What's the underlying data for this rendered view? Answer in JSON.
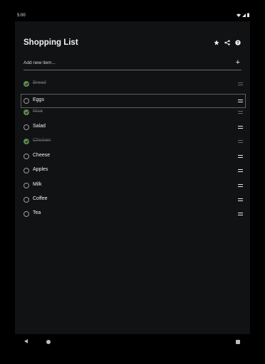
{
  "status": {
    "time": "5:00"
  },
  "app": {
    "title": "Shopping List"
  },
  "toolbar": {
    "favorite_icon": "star-icon",
    "share_icon": "share-icon",
    "help_icon": "help-icon"
  },
  "add": {
    "placeholder": "Add new item...",
    "button_icon": "plus-icon"
  },
  "items": [
    {
      "label": "Bread",
      "checked": true
    },
    {
      "label": "Eggs",
      "checked": false,
      "selected": true
    },
    {
      "label": "Rice",
      "checked": true
    },
    {
      "label": "Salad",
      "checked": false
    },
    {
      "label": "Chicken",
      "checked": true
    },
    {
      "label": "Cheese",
      "checked": false
    },
    {
      "label": "Apples",
      "checked": false
    },
    {
      "label": "Milk",
      "checked": false
    },
    {
      "label": "Coffee",
      "checked": false
    },
    {
      "label": "Tea",
      "checked": false
    }
  ],
  "colors": {
    "background": "#111214",
    "checked": "#5f8d4e",
    "text": "#f3f3f3",
    "muted": "#5f5f5f"
  }
}
